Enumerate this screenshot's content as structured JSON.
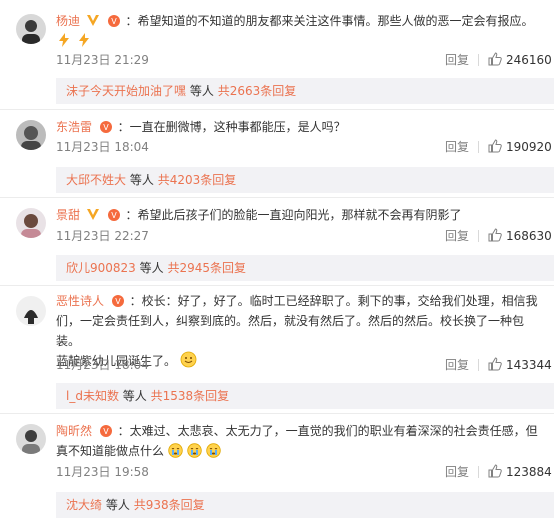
{
  "comments": [
    {
      "username": "杨迪",
      "text": "：希望知道的不知道的朋友都来关注这件事情。那些人做的恶一定会有报应。",
      "time": "11月23日 21:29",
      "reply_label": "回复",
      "likes": "246160",
      "sub_user": "沫子今天开始加油了嘿",
      "sub_mid": "等人",
      "sub_total": "共2663条回复",
      "emoji": [
        "lightning-icon",
        "lightning-icon",
        "lightning-icon"
      ]
    },
    {
      "username": "东浩雷",
      "text": "：一直在删微博，这种事都能压，是人吗？",
      "time": "11月23日 18:04",
      "reply_label": "回复",
      "likes": "190920",
      "sub_user": "大邱不姓大",
      "sub_mid": "等人",
      "sub_total": "共4203条回复"
    },
    {
      "username": "景甜",
      "text": "：希望此后孩子们的脸能一直迎向阳光，那样就不会再有阴影了",
      "time": "11月23日 22:27",
      "reply_label": "回复",
      "likes": "168630",
      "sub_user": "欣儿900823",
      "sub_mid": "等人",
      "sub_total": "共2945条回复"
    },
    {
      "username": "恶性诗人",
      "text_lines": [
        "：校长：好了，好了。临时工已经辞职了。剩下的事，交给我们处理，相信我",
        "们，一定会责任到人，纠察到底的。然后，就没有然后了。然后的然后。校长换了一种包装。",
        "蓝靛紫幼儿园诞生了。"
      ],
      "time": "11月23日 18:04",
      "reply_label": "回复",
      "likes": "143344",
      "sub_user": "l_d未知数",
      "sub_mid": "等人",
      "sub_total": "共1538条回复"
    },
    {
      "username": "陶昕然",
      "text_lines": [
        "：太难过、太悲哀、太无力了，一直觉的我们的职业有着深深的社会责任感，但",
        "真不知道能做点什么"
      ],
      "time": "11月23日 19:58",
      "reply_label": "回复",
      "likes": "123884",
      "sub_user": "沈大绮",
      "sub_mid": "等人",
      "sub_total": "共938条回复"
    }
  ],
  "colors": {
    "username": "#eb7350",
    "meta": "#808080",
    "subbg": "#f2f2f5",
    "vip": "#f5a623",
    "badge": "#f5a623"
  }
}
